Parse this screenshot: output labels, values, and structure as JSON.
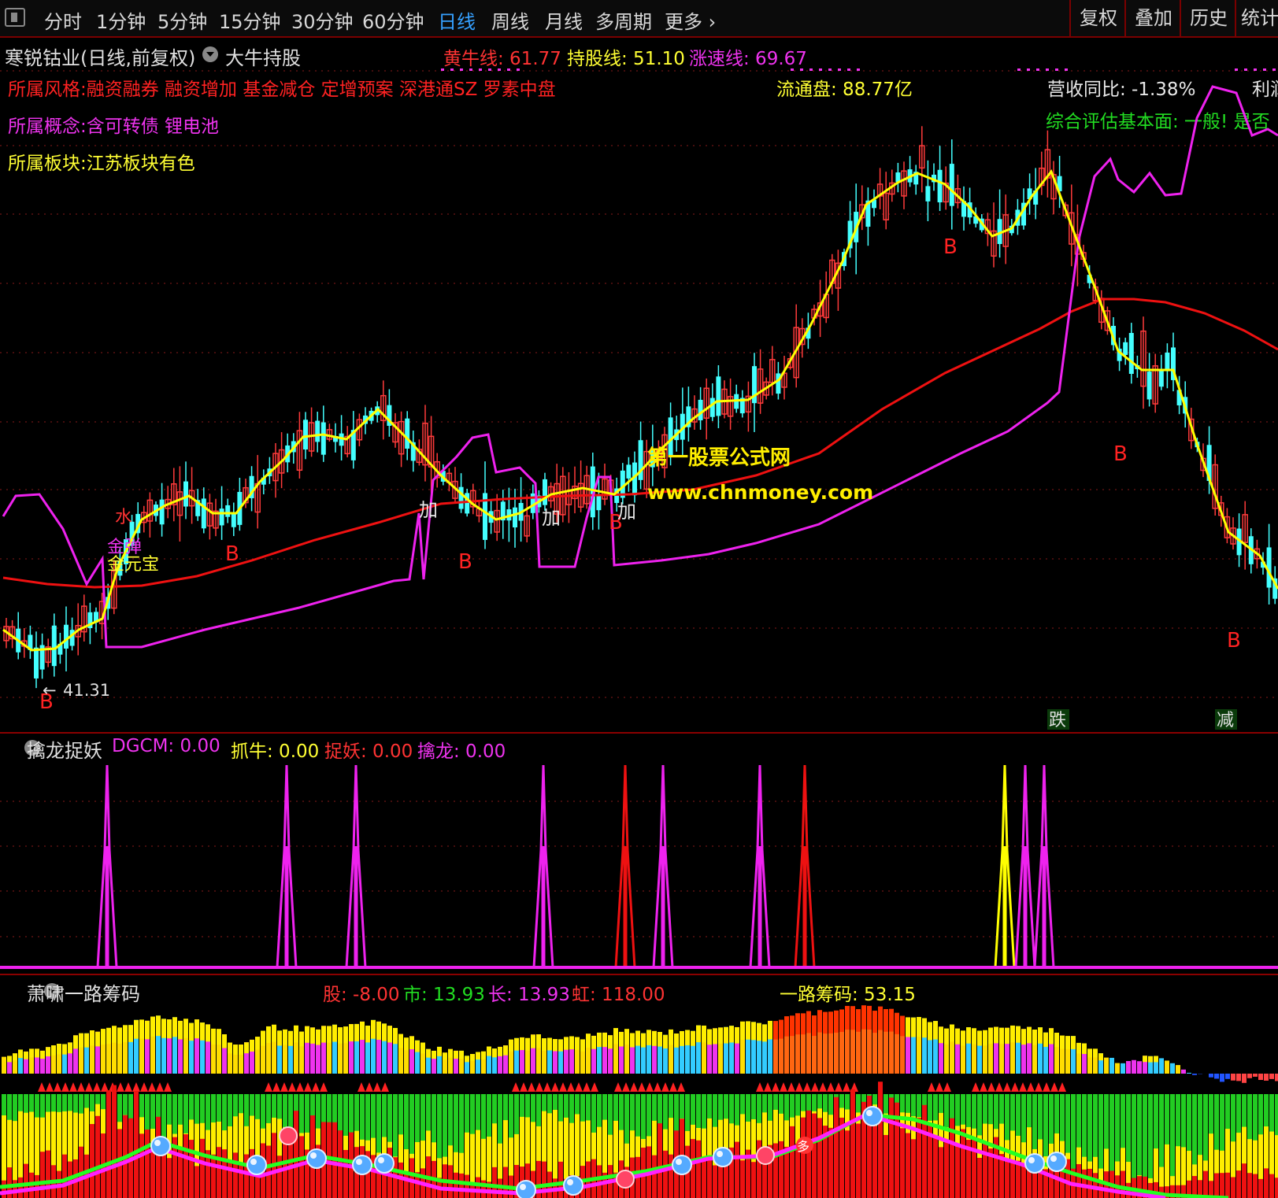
{
  "toolbar": {
    "tabs": [
      "分时",
      "1分钟",
      "5分钟",
      "15分钟",
      "30分钟",
      "60分钟",
      "日线",
      "周线",
      "月线",
      "多周期",
      "更多"
    ],
    "active_tab": "日线",
    "right_buttons": [
      "复权",
      "叠加",
      "历史",
      "统计"
    ]
  },
  "main": {
    "stock_title": "寒锐钴业(日线,前复权)",
    "indicator_name": "大牛持股",
    "hn_label": "黄牛线: 61.77",
    "hold_label": "持股线: 51.10",
    "speed_label": "涨速线: 69.67",
    "style_text": "所属风格:融资融券 融资增加 基金减仓 定增预案 深港通SZ 罗素中盘",
    "concept_text": "所属概念:含可转债 锂电池",
    "sector_text": "所属板块:江苏板块有色",
    "float_cap": "流通盘: 88.77亿",
    "revenue_yoy": "营收同比: -1.38%",
    "profit_cut": "利润",
    "fundamental": "综合评估基本面: 一般! 是否",
    "low_price": "41.31",
    "watermark_cn": "第一股票公式网",
    "watermark_url": "www.chnmoney.com",
    "tags": {
      "b": "B",
      "jia": "加",
      "jindan": "金弹",
      "jinyuanbao": "金元宝",
      "shui": "水",
      "die": "跌",
      "jian": "减"
    },
    "colors": {
      "up": "#ff3b3b",
      "down": "#44ffff",
      "yellow_line": "#ffff00",
      "red_line": "#ee1111",
      "magenta_line": "#ee22ee"
    }
  },
  "panel2": {
    "name": "擒龙捉妖",
    "dgcm": "DGCM: 0.00",
    "zhuaniu": "抓牛: 0.00",
    "zhuoyao": "捉妖: 0.00",
    "qinlong": "擒龙: 0.00"
  },
  "panel3": {
    "name": "萧啸一路筹码",
    "gu": "股: -8.00",
    "shi": "市: 13.93",
    "chang": "长: 13.93",
    "hong": "虹: 118.00",
    "yilu": "一路筹码: 53.15",
    "duo_badge": "多"
  }
}
